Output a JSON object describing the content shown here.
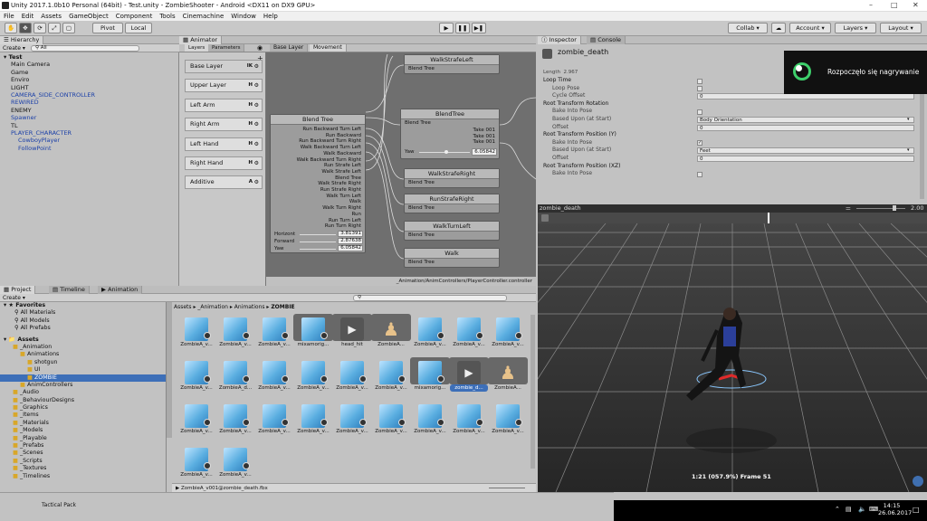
{
  "window": {
    "title": "Unity 2017.1.0b10 Personal (64bit) - Test.unity - ZombieShooter - Android <DX11 on DX9 GPU>"
  },
  "menu": [
    "File",
    "Edit",
    "Assets",
    "GameObject",
    "Component",
    "Tools",
    "Cinemachine",
    "Window",
    "Help"
  ],
  "toolbar": {
    "pivot": "Pivot",
    "local": "Local",
    "collab": "Collab",
    "account": "Account",
    "layers": "Layers",
    "layout": "Layout"
  },
  "hierarchy": {
    "tab": "Hierarchy",
    "create": "Create",
    "search": "All",
    "scene": "Test",
    "items": [
      {
        "label": "Main Camera",
        "blue": false,
        "indent": 1
      },
      {
        "label": "Game",
        "blue": false,
        "indent": 1
      },
      {
        "label": "Enviro",
        "blue": false,
        "indent": 1
      },
      {
        "label": "LIGHT",
        "blue": false,
        "indent": 1
      },
      {
        "label": "CAMERA_SIDE_CONTROLLER",
        "blue": true,
        "indent": 1
      },
      {
        "label": "REWIRED",
        "blue": true,
        "indent": 1
      },
      {
        "label": "ENEMY",
        "blue": false,
        "indent": 1
      },
      {
        "label": "Spawner",
        "blue": true,
        "indent": 1
      },
      {
        "label": "TL",
        "blue": false,
        "indent": 1
      },
      {
        "label": "PLAYER_CHARACTER",
        "blue": true,
        "indent": 1
      },
      {
        "label": "CowboyPlayer",
        "blue": true,
        "indent": 2
      },
      {
        "label": "FollowPoint",
        "blue": true,
        "indent": 2
      }
    ]
  },
  "animator": {
    "tab": "Animator",
    "layers_tab": "Layers",
    "parameters_tab": "Parameters",
    "breadcrumb": [
      "Base Layer",
      "Movement"
    ],
    "layers": [
      {
        "name": "Base Layer",
        "tag": "IK"
      },
      {
        "name": "Upper Layer",
        "tag": "H"
      },
      {
        "name": "Left Arm",
        "tag": "H"
      },
      {
        "name": "Right Arm",
        "tag": "H"
      },
      {
        "name": "Left Hand",
        "tag": "H"
      },
      {
        "name": "Right Hand",
        "tag": "H"
      },
      {
        "name": "Additive",
        "tag": "A"
      }
    ],
    "blend_tree": {
      "title": "Blend Tree",
      "inputs": [
        "Run Backward Turn Left",
        "Run Backward",
        "Run Backward Turn Right",
        "Walk Backward Turn Left",
        "Walk Backward",
        "Walk Backward Turn Right",
        "Run Strafe Left",
        "Walk Strafe Left",
        "Blend Tree",
        "Walk Strafe Right",
        "Run Strafe Right",
        "Walk Turn Left",
        "Walk",
        "Walk Turn Right",
        "Run",
        "Run Turn Left",
        "Run Turn Right"
      ],
      "params": [
        {
          "name": "Horizont",
          "value": "3.81391"
        },
        {
          "name": "Forward",
          "value": "2.87638"
        },
        {
          "name": "Yaw",
          "value": "6.05842"
        }
      ]
    },
    "nodes": [
      {
        "title": "WalkStrafeLeft",
        "sub": "Blend Tree"
      },
      {
        "title": "WalkStrafeRight",
        "sub": "Blend Tree"
      },
      {
        "title": "RunStrafeRight",
        "sub": "Blend Tree"
      },
      {
        "title": "WalkTurnLeft",
        "sub": "Blend Tree"
      },
      {
        "title": "Walk",
        "sub": "Blend Tree"
      }
    ],
    "center_node": {
      "title": "BlendTree",
      "sub": "Blend Tree",
      "takes": [
        "Take 001",
        "Take 001",
        "Take 001"
      ],
      "yaw_label": "Yaw",
      "yaw_value": "6.05842"
    },
    "footer_path": "_Animation/AnimControllers/PlayerController.controller"
  },
  "inspector": {
    "tab": "Inspector",
    "console_tab": "Console",
    "object_name": "zombie_death",
    "length_label": "Length",
    "length_value": "2.967",
    "rows": [
      {
        "type": "header",
        "label": "Loop Time",
        "control": "check",
        "checked": false
      },
      {
        "type": "sub",
        "label": "Loop Pose",
        "control": "check",
        "checked": false
      },
      {
        "type": "sub",
        "label": "Cycle Offset",
        "control": "field",
        "value": "0"
      },
      {
        "type": "header",
        "label": "Root Transform Rotation",
        "control": "none"
      },
      {
        "type": "sub",
        "label": "Bake Into Pose",
        "control": "check",
        "checked": false
      },
      {
        "type": "sub",
        "label": "Based Upon (at Start)",
        "control": "select",
        "value": "Body Orientation"
      },
      {
        "type": "sub",
        "label": "Offset",
        "control": "field",
        "value": "0"
      },
      {
        "type": "header",
        "label": "Root Transform Position (Y)",
        "control": "none"
      },
      {
        "type": "sub",
        "label": "Bake Into Pose",
        "control": "check",
        "checked": true
      },
      {
        "type": "sub",
        "label": "Based Upon (at Start)",
        "control": "select",
        "value": "Feet"
      },
      {
        "type": "sub",
        "label": "Offset",
        "control": "field",
        "value": "0"
      },
      {
        "type": "header",
        "label": "Root Transform Position (XZ)",
        "control": "none"
      },
      {
        "type": "sub",
        "label": "Bake Into Pose",
        "control": "check",
        "checked": false
      }
    ],
    "notification": "Rozpoczęło się nagrywanie"
  },
  "preview": {
    "clip_name": "zombie_death",
    "speed": "2.00",
    "frame_readout": "1:21 (057.9%) Frame 51"
  },
  "project": {
    "tabs": [
      "Project",
      "Timeline",
      "Animation"
    ],
    "create": "Create",
    "breadcrumb": [
      "Assets",
      "_Animation",
      "Animations",
      "ZOMBIE"
    ],
    "favorites_label": "Favorites",
    "favorites": [
      "All Materials",
      "All Models",
      "All Prefabs"
    ],
    "assets_label": "Assets",
    "tree": [
      {
        "label": "_Animation",
        "indent": 1
      },
      {
        "label": "Animations",
        "indent": 2
      },
      {
        "label": "shotgun",
        "indent": 3
      },
      {
        "label": "UI",
        "indent": 3
      },
      {
        "label": "ZOMBIE",
        "indent": 3,
        "selected": true
      },
      {
        "label": "AnimControllers",
        "indent": 2
      },
      {
        "label": "_Audio",
        "indent": 1
      },
      {
        "label": "_BehaviourDesigns",
        "indent": 1
      },
      {
        "label": "_Graphics",
        "indent": 1
      },
      {
        "label": "_Items",
        "indent": 1
      },
      {
        "label": "_Materials",
        "indent": 1
      },
      {
        "label": "_Models",
        "indent": 1
      },
      {
        "label": "_Playable",
        "indent": 1
      },
      {
        "label": "_Prefabs",
        "indent": 1
      },
      {
        "label": "_Scenes",
        "indent": 1
      },
      {
        "label": "_Scripts",
        "indent": 1
      },
      {
        "label": "_Textures",
        "indent": 1
      },
      {
        "label": "_Timelines",
        "indent": 1
      }
    ],
    "grid_rows": [
      [
        {
          "label": "ZombieA_v...",
          "kind": "cube"
        },
        {
          "label": "ZombieA_v...",
          "kind": "cube"
        },
        {
          "label": "ZombieA_v...",
          "kind": "cube"
        },
        {
          "label": "mixamorig...",
          "kind": "cube",
          "group": true
        },
        {
          "label": "head_hit",
          "kind": "play",
          "group": true
        },
        {
          "label": "ZombieA...",
          "kind": "avatar",
          "group": true
        },
        {
          "label": "ZombieA_v...",
          "kind": "cube"
        },
        {
          "label": "ZombieA_v...",
          "kind": "cube"
        },
        {
          "label": "ZombieA_v...",
          "kind": "cube"
        }
      ],
      [
        {
          "label": "ZombieA_v...",
          "kind": "cube"
        },
        {
          "label": "ZombieA_d...",
          "kind": "cube"
        },
        {
          "label": "ZombieA_v...",
          "kind": "cube"
        },
        {
          "label": "ZombieA_v...",
          "kind": "cube"
        },
        {
          "label": "ZombieA_v...",
          "kind": "cube"
        },
        {
          "label": "ZombieA_v...",
          "kind": "cube"
        },
        {
          "label": "mixamorig...",
          "kind": "cube",
          "group": true
        },
        {
          "label": "zombie_d...",
          "kind": "play",
          "group": true,
          "selected": true
        },
        {
          "label": "ZombieA...",
          "kind": "avatar",
          "group": true
        }
      ],
      [
        {
          "label": "ZombieA_v...",
          "kind": "cube"
        },
        {
          "label": "ZombieA_v...",
          "kind": "cube"
        },
        {
          "label": "ZombieA_v...",
          "kind": "cube"
        },
        {
          "label": "ZombieA_v...",
          "kind": "cube"
        },
        {
          "label": "ZombieA_v...",
          "kind": "cube"
        },
        {
          "label": "ZombieA_v...",
          "kind": "cube"
        },
        {
          "label": "ZombieA_v...",
          "kind": "cube"
        },
        {
          "label": "ZombieA_v...",
          "kind": "cube"
        },
        {
          "label": "ZombieA_v...",
          "kind": "cube"
        }
      ],
      [
        {
          "label": "ZombieA_v...",
          "kind": "cube"
        },
        {
          "label": "ZombieA_v...",
          "kind": "cube"
        }
      ]
    ],
    "footer_path": "ZombieA_v001@zombie_death.fbx"
  },
  "status": {
    "text": "Tactical Pack"
  },
  "taskbar": {
    "time": "14:15",
    "date": "26.06.2017"
  },
  "colors": {
    "selection": "#3d6fb8",
    "record_green": "#3ecf6b"
  }
}
